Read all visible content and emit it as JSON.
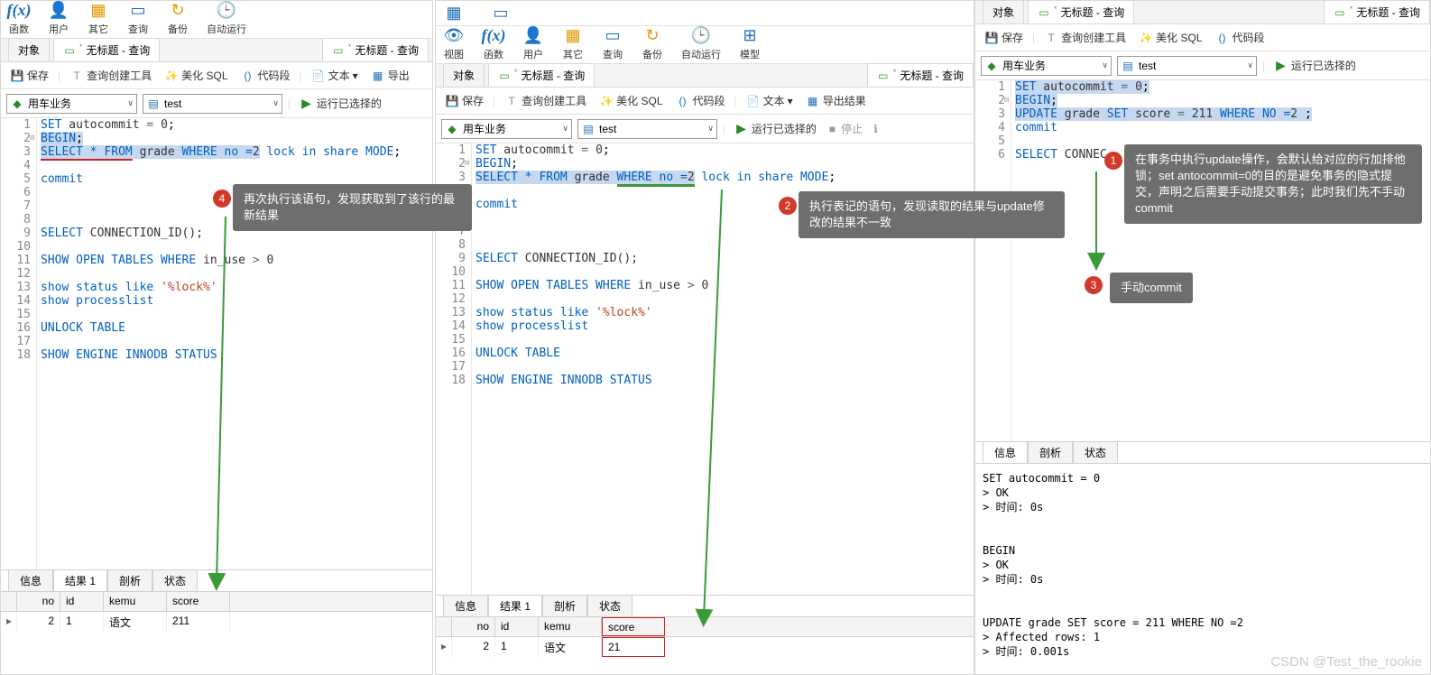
{
  "top_toolbar": {
    "fx": "函数",
    "user": "用户",
    "other": "其它",
    "query": "查询",
    "view": "视图",
    "backup": "备份",
    "auto": "自动运行",
    "model": "模型"
  },
  "tabs": {
    "object": "对象",
    "untitled_query": "无标题 - 查询"
  },
  "tool_row": {
    "save": "保存",
    "builder": "查询创建工具",
    "beautify": "美化 SQL",
    "snippet": "代码段",
    "text": "文本",
    "export": "导出结果",
    "exportShort": "导出"
  },
  "conn": {
    "db": "用车业务",
    "schema": "test",
    "run": "运行已选择的",
    "stop": "停止"
  },
  "code_left": {
    "l1": [
      "SET",
      " autocommit ",
      "=",
      " ",
      "0",
      ";"
    ],
    "l2": [
      "BEGIN",
      ";"
    ],
    "l3a": "SELECT * FROM",
    "l3b": " grade ",
    "l3c": "WHERE no =",
    "l3d": "2",
    "l3e": " lock in share MODE",
    "l3f": ";",
    "l5": "commit",
    "l9a": "SELECT",
    "l9b": " CONNECTION_ID();",
    "l11a": "SHOW OPEN TABLES WHERE",
    "l11b": " in_use ",
    "l11c": ">",
    "l11d": " 0",
    "l13a": "show status like ",
    "l13b": "'%lock%'",
    "l14": "show processlist",
    "l16": "UNLOCK TABLE",
    "l18": "SHOW ENGINE INNODB STATUS"
  },
  "code_right": {
    "l1": [
      "SET",
      " autocommit ",
      "=",
      " ",
      "0",
      ";"
    ],
    "l2": [
      "BEGIN",
      ";"
    ],
    "l3a": "UPDATE",
    "l3b": " grade ",
    "l3c": "SET",
    "l3d": " score ",
    "l3e": "=",
    "l3f": " 211 ",
    "l3g": "WHERE NO =",
    "l3h": "2",
    "l3i": " ;",
    "l4": "commit",
    "l6a": "SELECT",
    "l6b": " CONNEC"
  },
  "result": {
    "info": "信息",
    "result1": "结果 1",
    "profile": "剖析",
    "status": "状态",
    "col_no": "no",
    "col_id": "id",
    "col_kemu": "kemu",
    "col_score": "score",
    "r1_no": "2",
    "r1_id": "1",
    "r1_kemu": "语文",
    "r1_score_left": "211",
    "r1_score_mid": "21"
  },
  "messages": {
    "p3": "SET autocommit = 0\n> OK\n> 时间: 0s\n\n\nBEGIN\n> OK\n> 时间: 0s\n\n\nUPDATE grade SET score = 211 WHERE NO =2\n> Affected rows: 1\n> 时间: 0.001s"
  },
  "callouts": {
    "c1": "在事务中执行update操作，会默认给对应的行加排他锁；set antocommit=0的目的是避免事务的隐式提交，声明之后需要手动提交事务；此时我们先不手动commit",
    "c2": "执行表记的语句，发现读取的结果与update修改的结果不一致",
    "c3": "手动commit",
    "c4": "再次执行该语句，发现获取到了该行的最新结果"
  },
  "watermark": "CSDN @Test_the_rookie"
}
